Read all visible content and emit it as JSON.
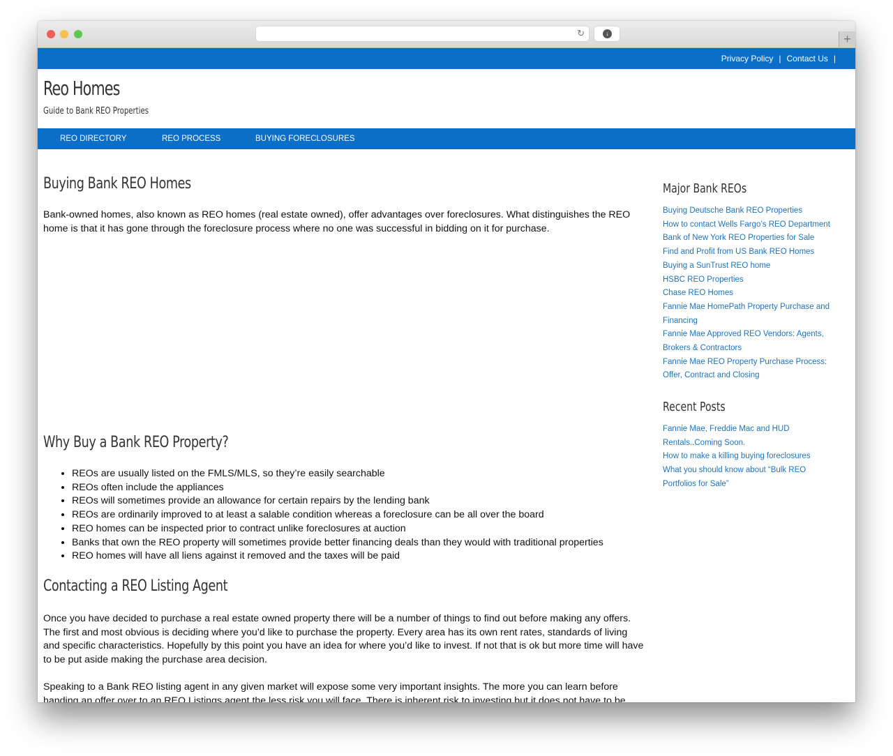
{
  "browser": {
    "url": "",
    "new_tab_label": "+",
    "reload_icon": "↻",
    "download_icon": "↓"
  },
  "topbar": {
    "links": [
      {
        "label": "Privacy Policy"
      },
      {
        "label": "Contact Us"
      }
    ],
    "separator": "|"
  },
  "site": {
    "title": "Reo Homes",
    "tagline": "Guide to Bank REO Properties"
  },
  "nav": {
    "items": [
      {
        "label": "REO DIRECTORY"
      },
      {
        "label": "REO PROCESS"
      },
      {
        "label": "BUYING FORECLOSURES"
      }
    ]
  },
  "article": {
    "title": "Buying Bank REO Homes",
    "intro": "Bank-owned homes, also known as REO homes (real estate owned), offer advantages over foreclosures. What distinguishes the REO home is that it has gone through the foreclosure process where no one was successful in bidding on it for purchase.",
    "section1": {
      "heading": "Why Buy a Bank REO Property?",
      "bullets": [
        "REOs are usually listed on the FMLS/MLS, so they’re easily searchable",
        "REOs often include the appliances",
        "REOs will sometimes provide an allowance for certain repairs by the lending bank",
        "REOs are ordinarily improved to at least a salable condition whereas a foreclosure can be all over the board",
        "REO homes can be inspected prior to contract unlike foreclosures at auction",
        "Banks that own the REO property will sometimes provide better financing deals than they would with traditional properties",
        "REO homes will have all liens against it removed and the taxes will be paid"
      ]
    },
    "section2": {
      "heading": "Contacting a REO Listing Agent",
      "para1": "Once you have decided to purchase a real estate owned property there will be a number of things to find out before making any offers. The first and most obvious is deciding where you’d like to purchase the property. Every area has its own rent rates, standards of living and specific characteristics. Hopefully by this point you have an idea for where you’d like to invest. If not that is ok but more time will have to be put aside making the purchase area decision.",
      "para2": "Speaking to a Bank REO listing agent in any given market will expose some very important insights. The more you can learn before handing an offer over to an REO Listings agent the less risk you will face. There is inherent risk to investing but it does not have to be"
    }
  },
  "sidebar": {
    "major_bank_reos": {
      "heading": "Major Bank REOs",
      "links": [
        "Buying Deutsche Bank REO Properties",
        "How to contact Wells Fargo’s REO Department",
        "Bank of New York REO Properties for Sale",
        "Find and Profit from US Bank REO Homes",
        "Buying a SunTrust REO home",
        "HSBC REO Properties",
        "Chase REO Homes",
        "Fannie Mae HomePath Property Purchase and Financing",
        "Fannie Mae Approved REO Vendors: Agents, Brokers & Contractors",
        "Fannie Mae REO Property Purchase Process: Offer, Contract and Closing"
      ]
    },
    "recent_posts": {
      "heading": "Recent Posts",
      "links": [
        "Fannie Mae, Freddie Mac and HUD Rentals..Coming Soon.",
        "How to make a killing buying foreclosures",
        "What you should know about “Bulk REO Portfolios for Sale”"
      ]
    }
  },
  "colors": {
    "brand_blue": "#0b6ec7",
    "link_blue": "#1e73be",
    "heading": "#333333"
  }
}
